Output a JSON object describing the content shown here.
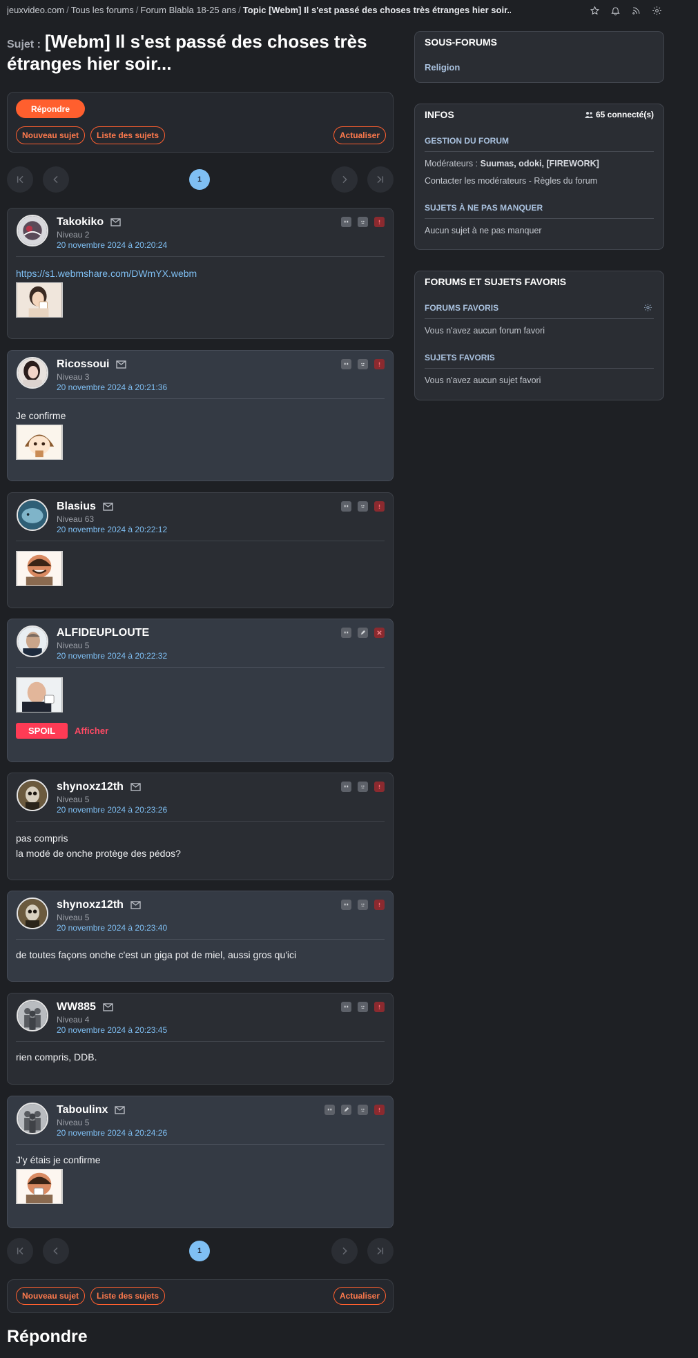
{
  "breadcrumb": {
    "items": [
      "jeuxvideo.com",
      "Tous les forums",
      "Forum Blabla 18-25 ans",
      "Topic [Webm] Il s'est passé des choses très étranges hier soir..."
    ]
  },
  "topic": {
    "prefix": "Sujet :",
    "title": "[Webm] Il s'est passé des choses très étranges hier soir..."
  },
  "actions": {
    "reply": "Répondre",
    "new_topic": "Nouveau sujet",
    "topic_list": "Liste des sujets",
    "refresh": "Actualiser"
  },
  "pagination": {
    "current": "1"
  },
  "posts": [
    {
      "author": "Takokiko",
      "level": "Niveau 2",
      "date": "20 novembre 2024 à 20:20:24",
      "link": "https://s1.webmshare.com/DWmYX.webm",
      "text": ""
    },
    {
      "author": "Ricossoui",
      "level": "Niveau 3",
      "date": "20 novembre 2024 à 20:21:36",
      "text": "Je confirme"
    },
    {
      "author": "Blasius",
      "level": "Niveau 63",
      "date": "20 novembre 2024 à 20:22:12",
      "text": ""
    },
    {
      "author": "ALFIDEUPLOUTE",
      "level": "Niveau 5",
      "date": "20 novembre 2024 à 20:22:32",
      "text": "",
      "spoil": "SPOIL",
      "spoil_show": "Afficher"
    },
    {
      "author": "shynoxz12th",
      "level": "Niveau 5",
      "date": "20 novembre 2024 à 20:23:26",
      "text": "pas compris",
      "text2": "la modé de onche protège des pédos?"
    },
    {
      "author": "shynoxz12th",
      "level": "Niveau 5",
      "date": "20 novembre 2024 à 20:23:40",
      "text": "de toutes façons onche c'est un giga pot de miel, aussi gros qu'ici"
    },
    {
      "author": "WW885",
      "level": "Niveau 4",
      "date": "20 novembre 2024 à 20:23:45",
      "text": "rien compris, DDB."
    },
    {
      "author": "Taboulinx",
      "level": "Niveau 5",
      "date": "20 novembre 2024 à 20:24:26",
      "text": "J'y étais je confirme"
    }
  ],
  "reply_section": {
    "title": "Répondre"
  },
  "sidebar": {
    "subforums": {
      "title": "SOUS-FORUMS",
      "items": [
        "Religion"
      ]
    },
    "infos": {
      "title": "INFOS",
      "connected": "65 connecté(s)",
      "management_title": "GESTION DU FORUM",
      "moderators_label": "Modérateurs :",
      "moderators": "Suumas, odoki, [FIREWORK]",
      "contact": "Contacter les modérateurs - Règles du forum",
      "must_see_title": "SUJETS À NE PAS MANQUER",
      "must_see_empty": "Aucun sujet à ne pas manquer"
    },
    "favorites": {
      "title": "FORUMS ET SUJETS FAVORIS",
      "forums_title": "FORUMS FAVORIS",
      "forums_empty": "Vous n'avez aucun forum favori",
      "topics_title": "SUJETS FAVORIS",
      "topics_empty": "Vous n'avez aucun sujet favori"
    }
  },
  "colors": {
    "accent": "#ff5f2e",
    "link": "#7fbff3",
    "background": "#1e2024"
  }
}
